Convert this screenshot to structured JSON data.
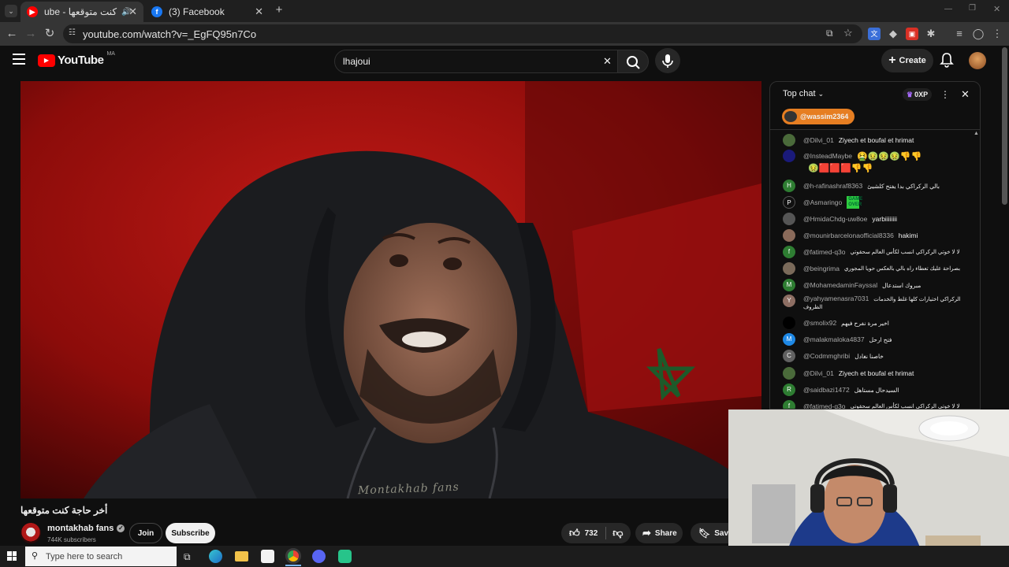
{
  "browser": {
    "tabs": [
      {
        "title": "ube - أخر حاجة كنت متوقعها",
        "active": true
      },
      {
        "title": "(3) Facebook",
        "active": false
      }
    ],
    "url": "youtube.com/watch?v=_EgFQ95n7Co"
  },
  "youtube": {
    "logo_text": "YouTube",
    "region": "MA",
    "search_value": "lhajoui",
    "create_label": "Create"
  },
  "video": {
    "title": "أخر حاجة كنت متوقعها",
    "shirt_text": "Montakhab fans"
  },
  "channel": {
    "name": "montakhab fans",
    "subscribers": "744K subscribers",
    "join_label": "Join",
    "subscribe_label": "Subscribe"
  },
  "actions": {
    "likes": "732",
    "share_label": "Share",
    "save_label": "Save"
  },
  "chat": {
    "mode_label": "Top chat",
    "points": "0XP",
    "pinned_user": "@wassim2364",
    "messages": [
      {
        "user": "@Dilvi_01",
        "text": "Ziyech et boufal et hrimat",
        "avatar": "",
        "avatar_color": "#4a6a3a"
      },
      {
        "user": "@InsteadMaybe",
        "text": "🤮🤢🤢🤢👎👎",
        "avatar": "",
        "avatar_color": "#1a1a7a"
      },
      {
        "user": "",
        "text": "🤢🟥🟥🟥👎👎",
        "avatar": "",
        "avatar_color": "transparent"
      },
      {
        "user": "@h-rafinashraf8363",
        "text": "بالي الركراكي بدا يفتح كلشيئ",
        "avatar": "H",
        "avatar_color": "#2e7d32"
      },
      {
        "user": "@Asmaringo",
        "text": "GAME OVER",
        "avatar": "P",
        "avatar_color": "#111111"
      },
      {
        "user": "@HmidaChdg-uw8oe",
        "text": "yarbiiiiiiii",
        "avatar": "",
        "avatar_color": "#555555"
      },
      {
        "user": "@mounirbarcelonaofficial8336",
        "text": "hakimi",
        "avatar": "",
        "avatar_color": "#8a6a5a"
      },
      {
        "user": "@fatimed-q3o",
        "text": "لا لا خوتي الركراكي انسب لكأس العالم سحقوتي",
        "avatar": "f",
        "avatar_color": "#2e7d32"
      },
      {
        "user": "@beingrima",
        "text": "بصراحة عليك تعطاء راه بالي بالعكس حويا المجوري",
        "avatar": "",
        "avatar_color": "#7a6a5a"
      },
      {
        "user": "@MohamedaminFayssal",
        "text": "مبروك استدعال",
        "avatar": "M",
        "avatar_color": "#2e7d32"
      },
      {
        "user": "@yahyamenasra7031",
        "text": "الركراكي اختيارات كلها غلط والخدمات الظروف",
        "avatar": "Y",
        "avatar_color": "#8d6e63"
      },
      {
        "user": "@smolix92",
        "text": "اخير مرة نفرح فيهم",
        "avatar": "",
        "avatar_color": "#000000"
      },
      {
        "user": "@malakmaloka4837",
        "text": "فتح ارحل",
        "avatar": "M",
        "avatar_color": "#1e88e5"
      },
      {
        "user": "@Codmmghribi",
        "text": "خاصنا نغادل",
        "avatar": "C",
        "avatar_color": "#616161"
      },
      {
        "user": "@Dilvi_01",
        "text": "Ziyech et boufal et hrimat",
        "avatar": "",
        "avatar_color": "#4a6a3a"
      },
      {
        "user": "@saidbazi1472",
        "text": "السيدحال مستاهل",
        "avatar": "R",
        "avatar_color": "#2e7d32"
      },
      {
        "user": "@fatimed-q3o",
        "text": "لا لا خوتي الركراكي انسب لكأس العالم سحقوتي",
        "avatar": "f",
        "avatar_color": "#2e7d32"
      }
    ]
  },
  "taskbar": {
    "search_placeholder": "Type here to search"
  }
}
